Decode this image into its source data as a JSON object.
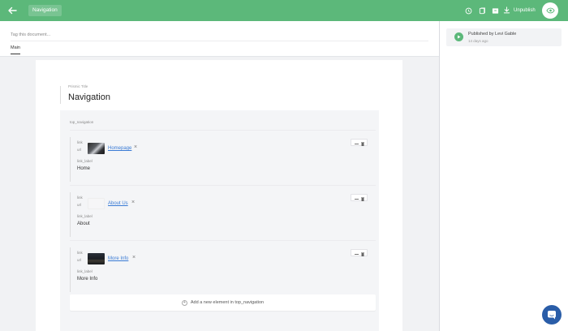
{
  "header": {
    "document_title": "Navigation",
    "unpublish_label": "Unpublish",
    "accent_color": "#5cb87a"
  },
  "icons": {
    "back": "arrow-left-icon",
    "history": "history-clock-icon",
    "copy": "copy-icon",
    "archive": "archive-icon",
    "unpublish": "download-arrow-icon",
    "preview": "eye-icon",
    "status": "play-icon",
    "chat": "chat-icon"
  },
  "tags": {
    "placeholder": "Tag this document..."
  },
  "tabs": [
    {
      "label": "Main",
      "active": true
    }
  ],
  "document": {
    "title_label": "Prismic Title",
    "title_value": "Navigation",
    "group_label": "top_navigation",
    "items": [
      {
        "link_label_field": "link",
        "url_field": "url",
        "link_text": "Homepage",
        "label_field": "link_label",
        "label_value": "Home"
      },
      {
        "link_label_field": "link",
        "url_field": "url",
        "link_text": "About Us",
        "label_field": "link_label",
        "label_value": "About"
      },
      {
        "link_label_field": "link",
        "url_field": "url",
        "link_text": "More Info",
        "label_field": "link_label",
        "label_value": "More Info"
      }
    ],
    "add_element_label": "Add a new element in top_navigation"
  },
  "status": {
    "text": "Published by Levi Gable",
    "time": "14 days ago"
  }
}
